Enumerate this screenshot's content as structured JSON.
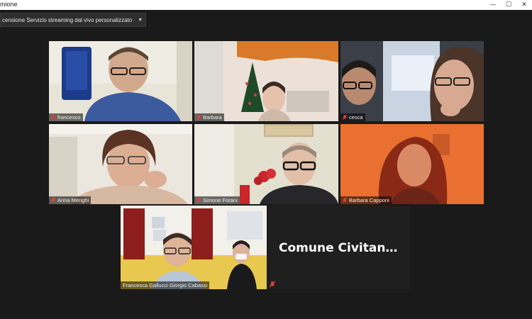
{
  "window": {
    "title": "mione",
    "controls": [
      "—",
      "☐",
      "✕"
    ]
  },
  "session": {
    "title": "censione Servizio streaming dal vivo personalizzato",
    "dropdown_icon": "caret-down"
  },
  "participants": [
    {
      "name": "francesco",
      "muted": true
    },
    {
      "name": "Barbara",
      "muted": true
    },
    {
      "name": "cesca",
      "muted": true
    },
    {
      "name": "Anna Menghi",
      "muted": true
    },
    {
      "name": "Simone Forani",
      "muted": true
    },
    {
      "name": "Barbara Capponi",
      "muted": true
    },
    {
      "name": "Francesca Gallucci Giorgio Cabassi",
      "muted": false,
      "active_speaker": true
    }
  ],
  "text_tile": {
    "label": "Comune  Civitan…",
    "muted": true
  },
  "colors": {
    "background": "#1a1a1a",
    "active_border": "#c9dd33",
    "mute_icon": "#e0403a"
  }
}
